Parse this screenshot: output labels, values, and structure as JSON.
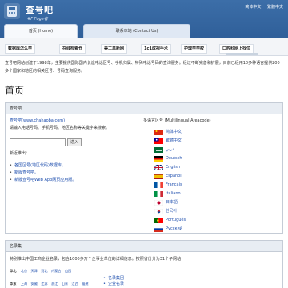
{
  "header": {
    "title": "查号吧",
    "subtitle": "#F Foge者",
    "lang_links": [
      "简体中文",
      "繁體中文"
    ],
    "nav": [
      {
        "label": "首页 (Home)"
      },
      {
        "label": "联系本站 (Contact Us)"
      }
    ]
  },
  "categories": [
    "数据库怎么学",
    "在线检索仓",
    "美工革新网",
    "1c1成视手术",
    "护理学学校",
    "口腔科网上找位"
  ],
  "intro": "查号吧网站创建于1998年，主要提供国际国内长途电话区号、手机归属、特殊电话号码的查询服务。经过不断完善和扩展，目前已经用10多种语言提供200多个国家和地区的相关区号、号码查询服务。",
  "page_title": "首页",
  "main_box": {
    "header": "查号吧",
    "site_url": "查号吧(www.chahaoba.com)",
    "prompt": "请输入电话号码、手机号码、地区名称等关键字来搜索。",
    "search_value": "",
    "search_button": "进入",
    "recommend_title": "新近推出：",
    "links": [
      "各国区号(地区代码)数据库。",
      "新版查号吧。",
      "新版查号吧Web App网页应用版。"
    ],
    "languages_title": "多语言区号 (Multilingual Areacode)",
    "languages": [
      {
        "label": "简体中文",
        "flag": "cn"
      },
      {
        "label": "繁體中文",
        "flag": "tw"
      },
      {
        "label": "عربي",
        "flag": "sa"
      },
      {
        "label": "Deutsch",
        "flag": "de"
      },
      {
        "label": "English",
        "flag": "gb"
      },
      {
        "label": "Español",
        "flag": "es"
      },
      {
        "label": "Français",
        "flag": "fr"
      },
      {
        "label": "Italiano",
        "flag": "it"
      },
      {
        "label": "日本語",
        "flag": "jp"
      },
      {
        "label": "한국어",
        "flag": "kr"
      },
      {
        "label": "Português",
        "flag": "pt"
      },
      {
        "label": "Русский",
        "flag": "ru"
      }
    ]
  },
  "section2": {
    "header": "名录集",
    "desc": "特别推出中国工商企业名录，包含1000多万个企事业单位的详细信息。按照省份分为31个子网站：",
    "row1_label": "华北",
    "row1_links": [
      "北京",
      "天津",
      "河北",
      "内蒙古",
      "山西"
    ],
    "row2_label": "华东",
    "row2_links": [
      "上海",
      "安徽",
      "江苏",
      "浙江",
      "山东",
      "江西",
      "福建"
    ],
    "mini_links": [
      "名录集团",
      "企业名录"
    ]
  }
}
